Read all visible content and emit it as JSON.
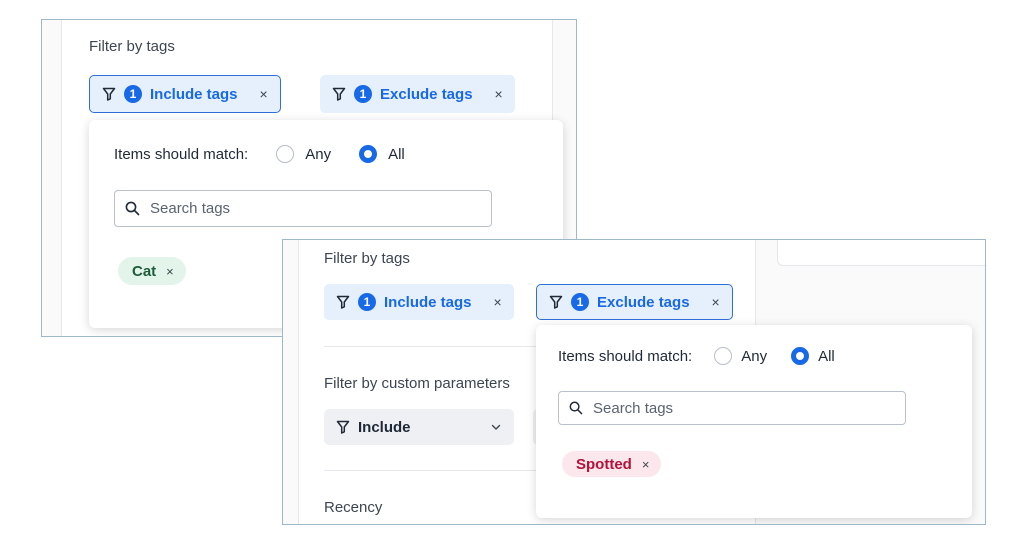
{
  "shot_a": {
    "filter_label": "Filter by tags",
    "include_chip": {
      "count": "1",
      "label": "Include tags",
      "close": "×"
    },
    "exclude_chip": {
      "count": "1",
      "label": "Exclude tags",
      "close": "×"
    },
    "popover": {
      "match_label": "Items should match:",
      "option_any": "Any",
      "option_all": "All",
      "selected": "All",
      "search_placeholder": "Search tags",
      "tags": [
        {
          "label": "Cat",
          "close": "×",
          "color": "#e3f4ea",
          "text_color": "#1f5c3a"
        }
      ]
    }
  },
  "shot_b": {
    "filter_label": "Filter by tags",
    "include_chip": {
      "count": "1",
      "label": "Include tags",
      "close": "×"
    },
    "exclude_chip": {
      "count": "1",
      "label": "Exclude tags",
      "close": "×"
    },
    "custom_params_label": "Filter by custom parameters",
    "include_dropdown": {
      "label": "Include"
    },
    "recency_label": "Recency",
    "popover": {
      "match_label": "Items should match:",
      "option_any": "Any",
      "option_all": "All",
      "selected": "All",
      "search_placeholder": "Search tags",
      "tags": [
        {
          "label": "Spotted",
          "close": "×",
          "color": "#fce8ec",
          "text_color": "#b3123a"
        }
      ]
    }
  },
  "colors": {
    "accent": "#1769e8",
    "chip_bg": "#e6f0fc",
    "frame_border": "#9cb8c9"
  }
}
